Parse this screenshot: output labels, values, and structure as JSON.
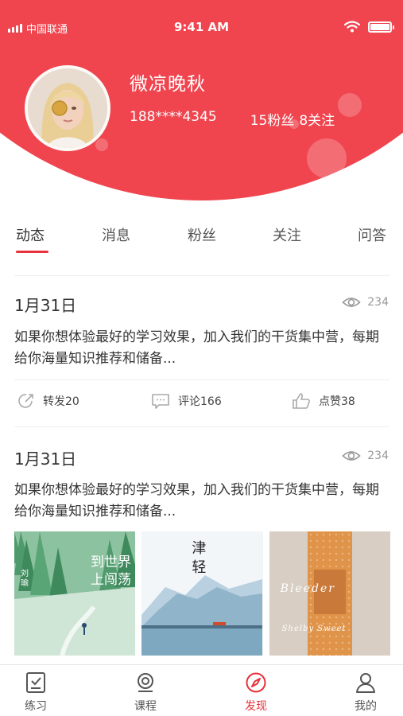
{
  "status_bar": {
    "carrier": "中国联通",
    "time": "9:41 AM"
  },
  "profile": {
    "name": "微凉晚秋",
    "phone": "188****4345",
    "fans": "15粉丝",
    "following": "8关注"
  },
  "tabs": [
    {
      "label": "动态",
      "active": true
    },
    {
      "label": "消息",
      "active": false
    },
    {
      "label": "粉丝",
      "active": false
    },
    {
      "label": "关注",
      "active": false
    },
    {
      "label": "问答",
      "active": false
    }
  ],
  "posts": [
    {
      "date": "1月31日",
      "views": "234",
      "body": "如果你想体验最好的学习效果，加入我们的干货集中营，每期给你海量知识推荐和储备...",
      "actions": {
        "share": "转发20",
        "comment": "评论166",
        "like": "点赞38"
      }
    },
    {
      "date": "1月31日",
      "views": "234",
      "body": "如果你想体验最好的学习效果，加入我们的干货集中营，每期给你海量知识推荐和储备...",
      "covers": [
        {
          "title": "到世界上闯荡",
          "author": "刘瑜"
        },
        {
          "title": "津轻"
        },
        {
          "title": "Bleeder",
          "author": "Shelby Sweet"
        }
      ]
    }
  ],
  "bottom_nav": [
    {
      "label": "练习",
      "icon": "practice-icon",
      "active": false
    },
    {
      "label": "课程",
      "icon": "course-icon",
      "active": false
    },
    {
      "label": "发现",
      "icon": "compass-icon",
      "active": true
    },
    {
      "label": "我的",
      "icon": "person-icon",
      "active": false
    }
  ],
  "colors": {
    "accent": "#f0454f",
    "active_tab_underline": "#e8323c"
  }
}
